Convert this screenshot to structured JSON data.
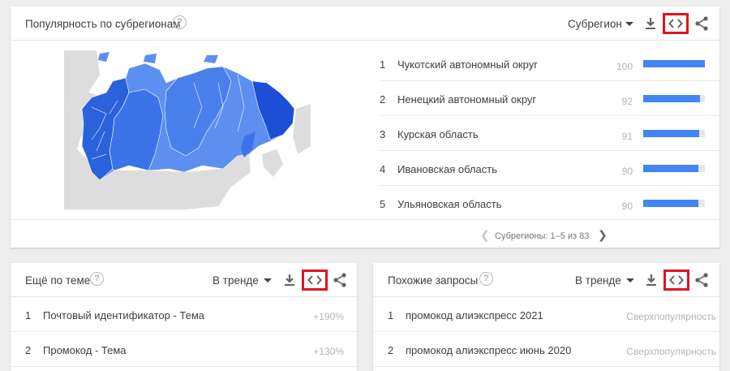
{
  "top_card": {
    "title": "Популярность по субрегионам",
    "dropdown_label": "Субрегион",
    "rows": [
      {
        "rank": "1",
        "name": "Чукотский автономный округ",
        "value": 100
      },
      {
        "rank": "2",
        "name": "Ненецкий автономный округ",
        "value": 92
      },
      {
        "rank": "3",
        "name": "Курская область",
        "value": 91
      },
      {
        "rank": "4",
        "name": "Ивановская область",
        "value": 90
      },
      {
        "rank": "5",
        "name": "Ульяновская область",
        "value": 90
      }
    ],
    "pagination": "Субрегионы: 1–5 из 83"
  },
  "left_card": {
    "title": "Ещё по теме",
    "dropdown_label": "В тренде",
    "rows": [
      {
        "rank": "1",
        "name": "Почтовый идентификатор - Тема",
        "value": "+190%"
      },
      {
        "rank": "2",
        "name": "Промокод - Тема",
        "value": "+130%"
      }
    ]
  },
  "right_card": {
    "title": "Похожие запросы",
    "dropdown_label": "В тренде",
    "rows": [
      {
        "rank": "1",
        "name": "промокод алиэкспресс 2021",
        "value": "Сверхпопулярность"
      },
      {
        "rank": "2",
        "name": "промокод алиэкспресс июнь 2020",
        "value": "Сверхпопулярность"
      }
    ]
  },
  "colors": {
    "bar": "#4285f4",
    "map_dark": "#1a56db",
    "map_mid": "#3b74e8",
    "map_light": "#5c8ff0",
    "map_neutral": "#dddddd",
    "highlight_box": "#e0141e"
  },
  "icons": {
    "help": "help-circle-icon",
    "caret": "caret-down-icon",
    "download": "download-icon",
    "embed": "embed-code-icon",
    "share": "share-icon",
    "prev": "chevron-left-icon",
    "next": "chevron-right-icon"
  }
}
